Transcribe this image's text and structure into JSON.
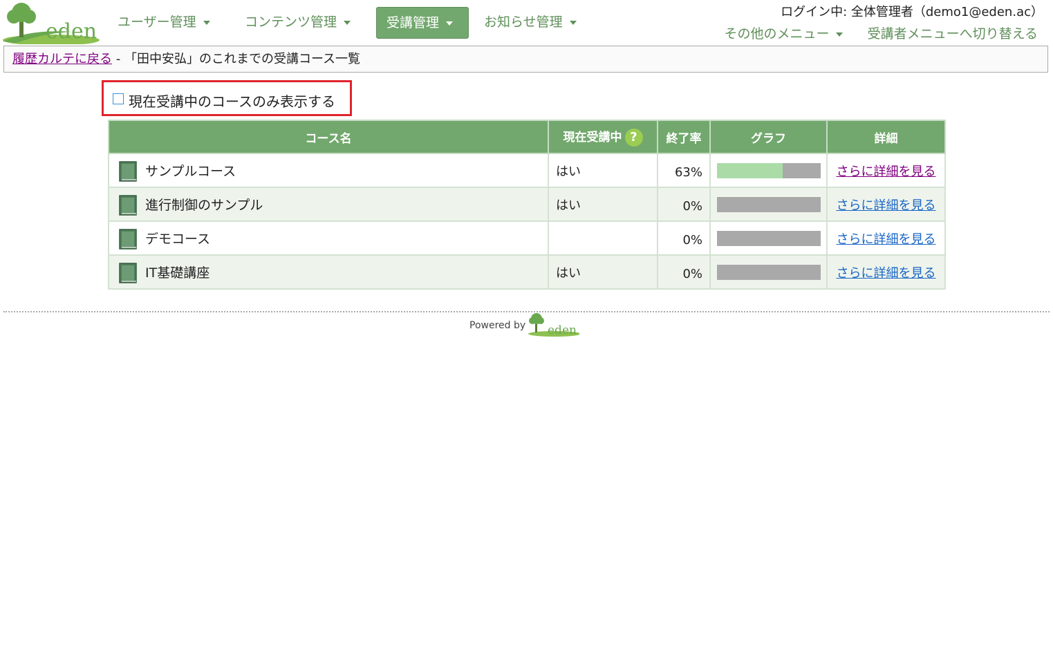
{
  "header": {
    "logo_text": "eden",
    "nav": [
      {
        "label": "ユーザー管理"
      },
      {
        "label": "コンテンツ管理"
      },
      {
        "label": "受講管理"
      },
      {
        "label": "お知らせ管理"
      }
    ],
    "login_info": "ログイン中: 全体管理者（demo1@eden.ac）",
    "other_menu": "その他のメニュー",
    "switch_menu": "受講者メニューへ切り替える"
  },
  "breadcrumb": {
    "back_link": "履歴カルテに戻る",
    "separator": " - ",
    "title": "「田中安弘」のこれまでの受講コース一覧"
  },
  "filter": {
    "checked": false,
    "label": "現在受講中のコースのみ表示する"
  },
  "table": {
    "headers": {
      "course": "コース名",
      "current": "現在受講中",
      "rate": "終了率",
      "graph": "グラフ",
      "detail": "詳細"
    },
    "help_icon": "?",
    "rows": [
      {
        "name": "サンプルコース",
        "current": "はい",
        "rate": "63%",
        "progress": 0.63,
        "detail": "さらに詳細を見る"
      },
      {
        "name": "進行制御のサンプル",
        "current": "はい",
        "rate": "0%",
        "progress": 0,
        "detail": "さらに詳細を見る"
      },
      {
        "name": "デモコース",
        "current": "",
        "rate": "0%",
        "progress": 0,
        "detail": "さらに詳細を見る"
      },
      {
        "name": "IT基礎講座",
        "current": "はい",
        "rate": "0%",
        "progress": 0,
        "detail": "さらに詳細を見る"
      }
    ]
  },
  "footer": {
    "powered_by": "Powered by",
    "logo_text": "eden"
  },
  "colors": {
    "accent_green": "#72a86d",
    "progress_fill": "#abdca8",
    "progress_track": "#a9a9a9",
    "highlight_border": "#e0242b"
  }
}
